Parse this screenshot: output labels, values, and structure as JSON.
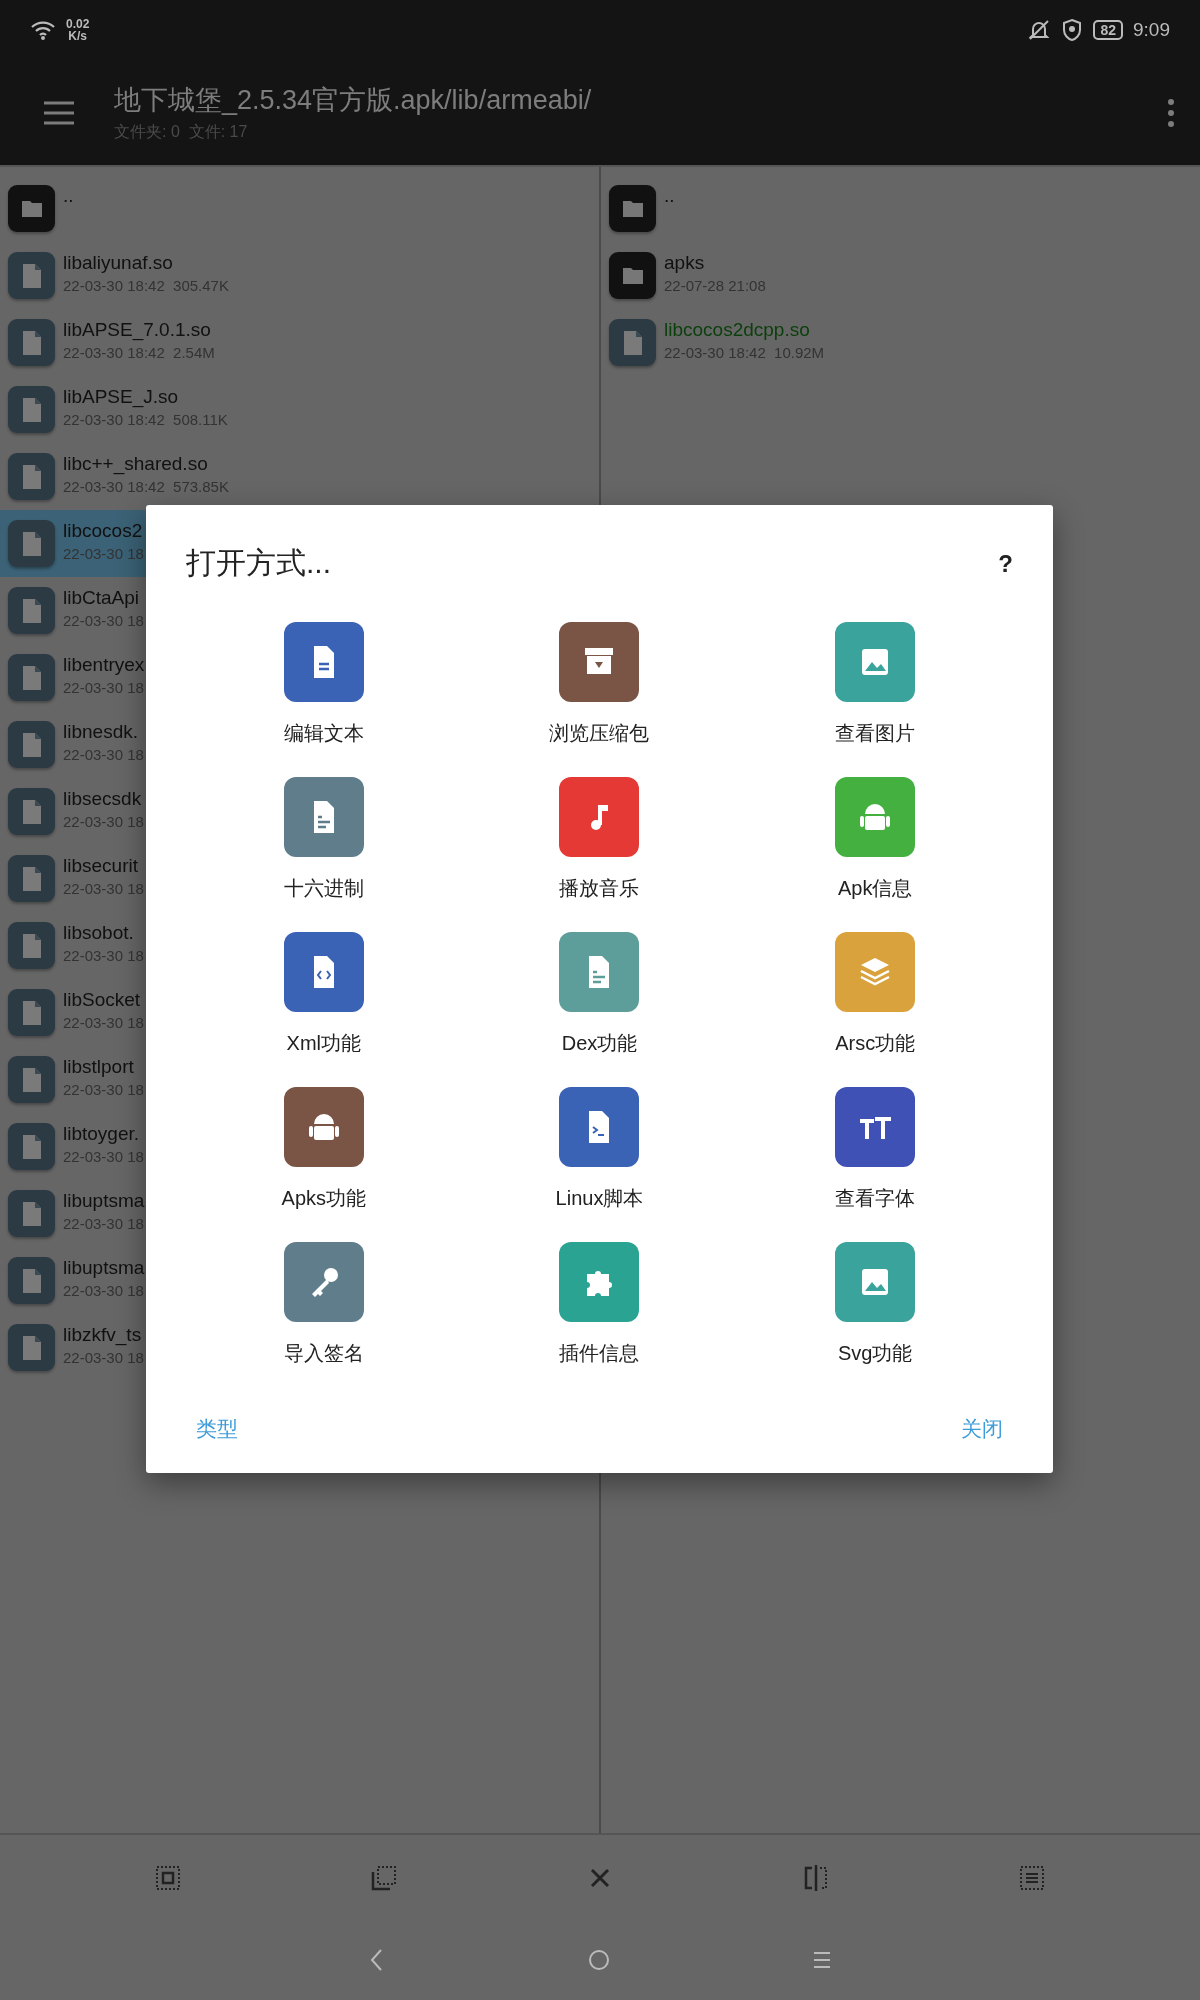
{
  "status_bar": {
    "net_speed": "0.02",
    "net_unit": "K/s",
    "battery": "82",
    "time": "9:09"
  },
  "header": {
    "title": "地下城堡_2.5.34官方版.apk/lib/armeabi/",
    "subtitle": "文件夹: 0  文件: 17"
  },
  "left_panel": {
    "items": [
      {
        "kind": "folder",
        "name": "..",
        "selected": false
      },
      {
        "kind": "file",
        "name": "libaliyunaf.so",
        "meta": "22-03-30 18:42  305.47K",
        "selected": false
      },
      {
        "kind": "file",
        "name": "libAPSE_7.0.1.so",
        "meta": "22-03-30 18:42  2.54M",
        "selected": false
      },
      {
        "kind": "file",
        "name": "libAPSE_J.so",
        "meta": "22-03-30 18:42  508.11K",
        "selected": false
      },
      {
        "kind": "file",
        "name": "libc++_shared.so",
        "meta": "22-03-30 18:42  573.85K",
        "selected": false
      },
      {
        "kind": "file",
        "name": "libcocos2",
        "meta": "22-03-30 18",
        "selected": true
      },
      {
        "kind": "file",
        "name": "libCtaApi",
        "meta": "22-03-30 18",
        "selected": false
      },
      {
        "kind": "file",
        "name": "libentryex",
        "meta": "22-03-30 18",
        "selected": false
      },
      {
        "kind": "file",
        "name": "libnesdk.",
        "meta": "22-03-30 18",
        "selected": false
      },
      {
        "kind": "file",
        "name": "libsecsdk",
        "meta": "22-03-30 18",
        "selected": false
      },
      {
        "kind": "file",
        "name": "libsecurit",
        "meta": "22-03-30 18",
        "selected": false
      },
      {
        "kind": "file",
        "name": "libsobot.",
        "meta": "22-03-30 18",
        "selected": false
      },
      {
        "kind": "file",
        "name": "libSocket",
        "meta": "22-03-30 18",
        "selected": false
      },
      {
        "kind": "file",
        "name": "libstlport",
        "meta": "22-03-30 18",
        "selected": false
      },
      {
        "kind": "file",
        "name": "libtoyger.",
        "meta": "22-03-30 18",
        "selected": false
      },
      {
        "kind": "file",
        "name": "libuptsma",
        "meta": "22-03-30 18",
        "selected": false
      },
      {
        "kind": "file",
        "name": "libuptsma",
        "meta": "22-03-30 18",
        "selected": false
      },
      {
        "kind": "file",
        "name": "libzkfv_ts",
        "meta": "22-03-30 18",
        "selected": false
      }
    ]
  },
  "right_panel": {
    "items": [
      {
        "kind": "folder",
        "name": "..",
        "marked": false
      },
      {
        "kind": "folder",
        "name": "apks",
        "meta": "22-07-28 21:08",
        "marked": false
      },
      {
        "kind": "file",
        "name": "libcocos2dcpp.so",
        "meta": "22-03-30 18:42  10.92M",
        "marked": true
      }
    ]
  },
  "dialog": {
    "title": "打开方式...",
    "help": "?",
    "options": [
      {
        "label": "编辑文本",
        "color": "#3a62b5"
      },
      {
        "label": "浏览压缩包",
        "color": "#7a5444"
      },
      {
        "label": "查看图片",
        "color": "#3aa39b"
      },
      {
        "label": "十六进制",
        "color": "#607d8b"
      },
      {
        "label": "播放音乐",
        "color": "#e53935"
      },
      {
        "label": "Apk信息",
        "color": "#43b040"
      },
      {
        "label": "Xml功能",
        "color": "#3a62b5"
      },
      {
        "label": "Dex功能",
        "color": "#5e9e9a"
      },
      {
        "label": "Arsc功能",
        "color": "#d9a23d"
      },
      {
        "label": "Apks功能",
        "color": "#7a5444"
      },
      {
        "label": "Linux脚本",
        "color": "#3a62b5"
      },
      {
        "label": "查看字体",
        "color": "#3f51b5"
      },
      {
        "label": "导入签名",
        "color": "#607d8b"
      },
      {
        "label": "插件信息",
        "color": "#2aa393"
      },
      {
        "label": "Svg功能",
        "color": "#3aa39b"
      }
    ],
    "buttons": [
      "类型",
      "关闭"
    ]
  }
}
